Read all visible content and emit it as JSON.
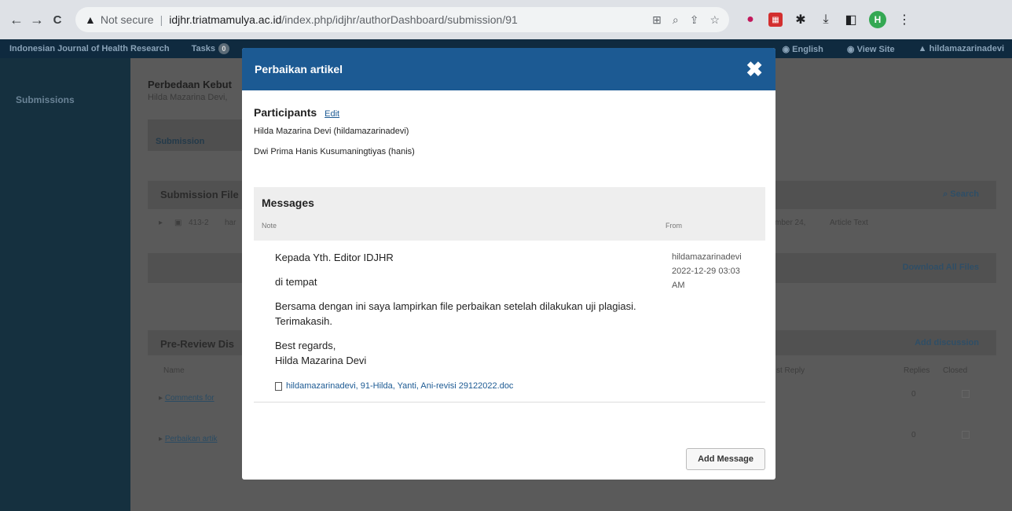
{
  "browser": {
    "back_glyph": "←",
    "forward_glyph": "→",
    "reload_glyph": "C",
    "security_label": "Not secure",
    "url_host": "idjhr.triatmamulya.ac.id",
    "url_path": "/index.php/idjhr/authorDashboard/submission/91",
    "profile_initial": "H"
  },
  "header": {
    "site_name": "Indonesian Journal of Health Research",
    "tasks_label": "Tasks",
    "tasks_count": "0",
    "language": "English",
    "view_site": "View Site",
    "user": "hildamazarinadevi"
  },
  "sidebar": {
    "items": [
      {
        "label": "Submissions"
      }
    ]
  },
  "background": {
    "title": "Perbedaan Kebut",
    "author": "Hilda Mazarina Devi,",
    "tab_label": "Submission",
    "files_panel_title": "Submission File",
    "search_label": "Search",
    "file_row_id": "413-2",
    "file_row_name": "har",
    "file_row_date": "mber 24,",
    "file_row_type": "Article Text",
    "download_all": "Download All Files",
    "discussions_title": "Pre-Review Dis",
    "add_discussion": "Add discussion",
    "col_name": "Name",
    "col_last_reply": "st Reply",
    "col_replies": "Replies",
    "col_closed": "Closed",
    "discussions": [
      {
        "name": "Comments for",
        "replies": "0"
      },
      {
        "name": "Perbaikan artik",
        "replies": "0"
      }
    ]
  },
  "modal": {
    "title": "Perbaikan artikel",
    "close_glyph": "✖",
    "participants_label": "Participants",
    "edit_label": "Edit",
    "participants": [
      "Hilda Mazarina Devi (hildamazarinadevi)",
      "Dwi Prima Hanis Kusumaningtiyas (hanis)"
    ],
    "messages_title": "Messages",
    "col_note": "Note",
    "col_from": "From",
    "message": {
      "line1": "Kepada Yth. Editor IDJHR",
      "line2": "di tempat",
      "line3": "Bersama dengan ini saya lampirkan file perbaikan setelah dilakukan uji plagiasi.",
      "line4": "Terimakasih.",
      "line5": "Best regards,",
      "line6": "Hilda Mazarina Devi",
      "attachment": "hildamazarinadevi, 91-Hilda, Yanti, Ani-revisi 29122022.doc",
      "from_user": "hildamazarinadevi",
      "from_date": "2022-12-29 03:03 AM"
    },
    "add_message_label": "Add Message"
  }
}
